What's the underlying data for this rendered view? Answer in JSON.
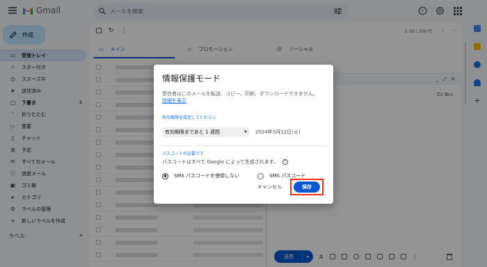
{
  "header": {
    "app_name": "Gmail",
    "search_placeholder": "メールを検索",
    "icons": [
      "menu-icon",
      "search-icon",
      "tune-icon",
      "help-icon",
      "settings-icon",
      "apps-icon"
    ]
  },
  "sidebar": {
    "compose_label": "作成",
    "items": [
      {
        "label": "受信トレイ",
        "icon": "inbox-icon",
        "active": true
      },
      {
        "label": "スター付き",
        "icon": "star-icon"
      },
      {
        "label": "スヌーズ中",
        "icon": "clock-icon"
      },
      {
        "label": "送信済み",
        "icon": "send-icon"
      },
      {
        "label": "下書き",
        "icon": "draft-icon",
        "count": "1"
      },
      {
        "label": "折りたたむ",
        "icon": "collapse-icon"
      },
      {
        "label": "重要",
        "icon": "important-icon"
      },
      {
        "label": "チャット",
        "icon": "chat-icon"
      },
      {
        "label": "予定",
        "icon": "scheduled-icon"
      },
      {
        "label": "すべてのメール",
        "icon": "all-mail-icon"
      },
      {
        "label": "迷惑メール",
        "icon": "spam-icon"
      },
      {
        "label": "ゴミ箱",
        "icon": "trash-icon"
      },
      {
        "label": "カテゴリ",
        "icon": "category-icon"
      },
      {
        "label": "ラベルの管理",
        "icon": "manage-labels-icon"
      },
      {
        "label": "新しいラベルを作成",
        "icon": "plus-icon"
      }
    ],
    "labels_heading": "ラベル",
    "labels_add": "+"
  },
  "main": {
    "pager": "1–50 / 209 行",
    "tabs": [
      {
        "label": "メイン",
        "active": true
      },
      {
        "label": "プロモーション"
      },
      {
        "label": "ソーシャル"
      }
    ]
  },
  "compose_window": {
    "cc_bcc": "Cc Bcc",
    "send_label": "送信",
    "send_more": "▾"
  },
  "dialog": {
    "title": "情報保護モード",
    "description": "受信者はこのメールを転送、コピー、印刷、ダウンロードできません。",
    "details_link": "詳細を表示",
    "expiry_label": "有効期限を設定してください",
    "expiry_select": "有効期限まであと 1 週間",
    "expiry_date": "2024年3月12日(火)",
    "passcode_label": "パスコードが必要です",
    "passcode_note": "パスコードはすべて Google によって生成されます。",
    "radio_no_sms": "SMS パスコードを使用しない",
    "radio_sms": "SMS パスコード",
    "selected_radio": "no_sms",
    "cancel_label": "キャンセル",
    "save_label": "保存",
    "highlight_color": "#ff2b0b",
    "accent_color": "#0b57d0"
  }
}
